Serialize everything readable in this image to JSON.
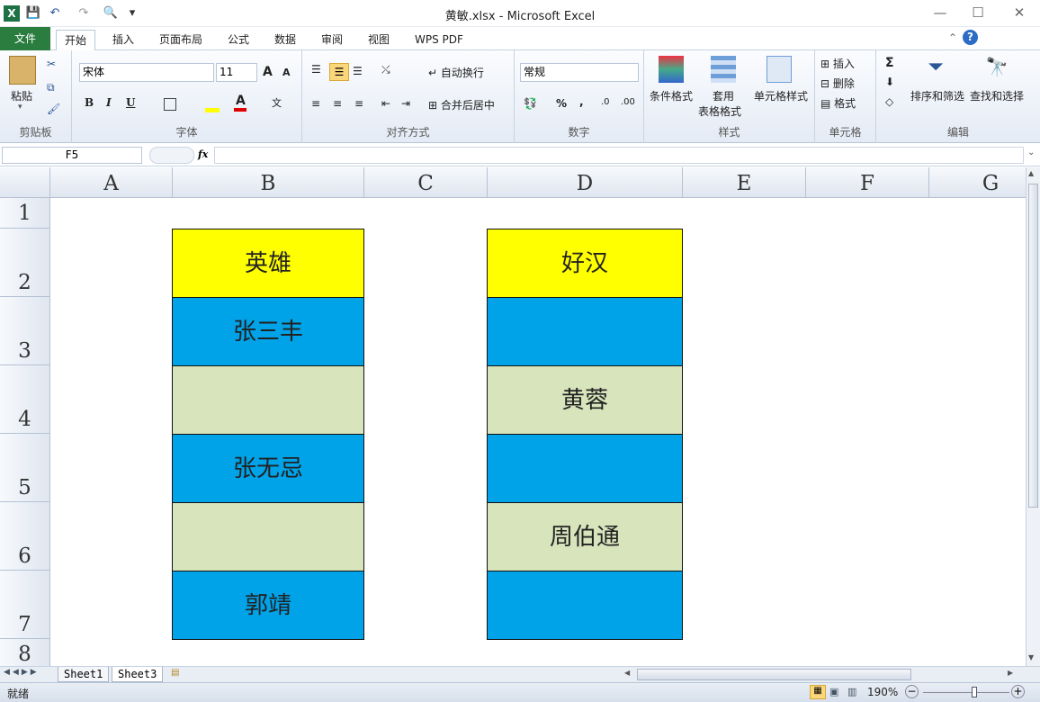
{
  "window": {
    "title": "黄敏.xlsx - Microsoft Excel",
    "min": "—",
    "max": "☐",
    "close": "✕"
  },
  "quick_access": [
    "X",
    "💾",
    "↶",
    "↷",
    "🔍",
    "▾"
  ],
  "tabs": {
    "file": "文件",
    "items": [
      "开始",
      "插入",
      "页面布局",
      "公式",
      "数据",
      "审阅",
      "视图",
      "WPS PDF"
    ]
  },
  "ribbon": {
    "clipboard": {
      "paste": "粘贴",
      "label": "剪贴板"
    },
    "font": {
      "name": "宋体",
      "size": "11",
      "grow": "A",
      "shrink": "A",
      "bold": "B",
      "italic": "I",
      "underline": "U",
      "label": "字体"
    },
    "align": {
      "wrap": "自动换行",
      "merge": "合并后居中",
      "label": "对齐方式"
    },
    "number": {
      "format": "常规",
      "percent": "%",
      "comma": ",",
      "label": "数字"
    },
    "styles": {
      "cond": "条件格式",
      "table1": "套用",
      "table2": "表格格式",
      "cell": "单元格样式",
      "label": "样式"
    },
    "cells": {
      "insert": "插入",
      "delete": "删除",
      "format": "格式",
      "label": "单元格"
    },
    "edit": {
      "sum": "Σ",
      "sort": "排序和筛选",
      "find": "查找和选择",
      "label": "编辑"
    }
  },
  "formula_bar": {
    "namebox": "F5",
    "fx": "fx",
    "value": ""
  },
  "columns": [
    "A",
    "B",
    "C",
    "D",
    "E",
    "F",
    "G"
  ],
  "rows": [
    "1",
    "2",
    "3",
    "4",
    "5",
    "6",
    "7",
    "8"
  ],
  "colors": {
    "yellow": "#ffff00",
    "blue": "#00a2e8",
    "green": "#d8e4bc"
  },
  "colB": [
    "英雄",
    "张三丰",
    "",
    "张无忌",
    "",
    "郭靖"
  ],
  "colD": [
    "好汉",
    "",
    "黄蓉",
    "",
    "周伯通",
    ""
  ],
  "sheets": [
    "Sheet1",
    "Sheet3"
  ],
  "status": {
    "ready": "就绪",
    "zoom": "190%",
    "minus": "−",
    "plus": "+"
  }
}
